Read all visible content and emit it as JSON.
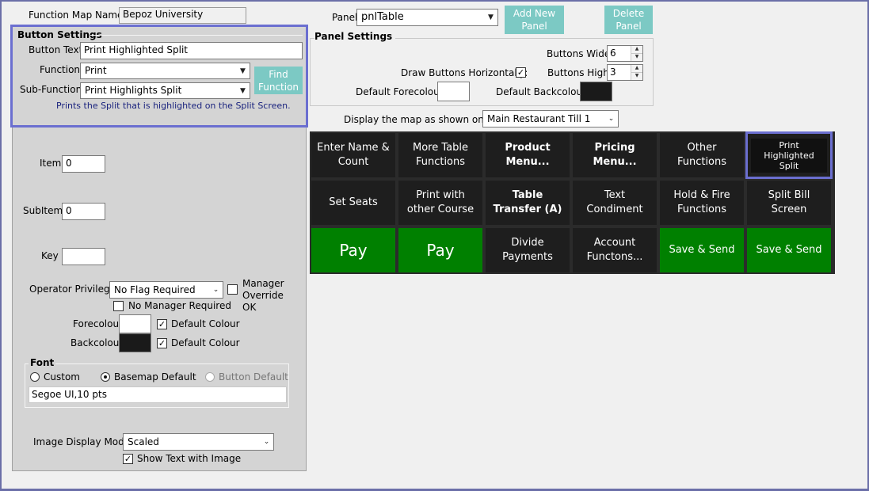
{
  "function_map": {
    "label": "Function Map Name:",
    "value": "Bepoz University"
  },
  "button_settings": {
    "title": "Button Settings",
    "button_text_label": "Button Text",
    "button_text_value": "Print Highlighted Split",
    "function_label": "Function",
    "function_value": "Print",
    "sub_function_label": "Sub-Function",
    "sub_function_value": "Print Highlights Split",
    "find_function_label": "Find Function",
    "description": "Prints the Split that is highlighted on the Split Screen."
  },
  "details": {
    "item_label": "Item",
    "item_value": "0",
    "subitem_label": "SubItem",
    "subitem_value": "0",
    "key_label": "Key",
    "key_value": "",
    "operator_privilege_label": "Operator Privilege:",
    "operator_privilege_value": "No Flag Required",
    "manager_override_label": "Manager Override OK",
    "no_manager_required_label": "No Manager Required",
    "forecolour_label": "Forecolour",
    "backcolour_label": "Backcolour",
    "default_colour_label": "Default Colour",
    "forecolour_hex": "#ffffff",
    "backcolour_hex": "#1a1a1a"
  },
  "font": {
    "title": "Font",
    "custom_label": "Custom",
    "basemap_label": "Basemap Default",
    "button_default_label": "Button Default",
    "selected": "Basemap Default",
    "value": "Segoe UI,10 pts"
  },
  "image": {
    "label": "Image Display Mode:",
    "value": "Scaled",
    "show_text_label": "Show Text with Image",
    "show_text_checked": true
  },
  "panel": {
    "label": "Panel",
    "value": "pnlTable",
    "add_new_label": "Add New Panel",
    "delete_label": "Delete Panel"
  },
  "panel_settings": {
    "title": "Panel Settings",
    "buttons_wide_label": "Buttons Wide:",
    "buttons_wide_value": "6",
    "buttons_high_label": "Buttons High:",
    "buttons_high_value": "3",
    "draw_horizontally_label": "Draw Buttons Horizontally:",
    "draw_horizontally_checked": true,
    "default_forecolour_label": "Default Forecolour",
    "default_backcolour_label": "Default Backcolour",
    "default_forecolour_hex": "#ffffff",
    "default_backcolour_hex": "#1a1a1a"
  },
  "display": {
    "label": "Display the map as shown on till:",
    "value": "Main Restaurant Till 1"
  },
  "map_buttons": [
    [
      "Enter Name & Count",
      "More Table Functions",
      "Product Menu...",
      "Pricing Menu...",
      "Other Functions",
      "Print Highlighted Split"
    ],
    [
      "Set Seats",
      "Print with other Course",
      "Table Transfer (A)",
      "Text Condiment",
      "Hold & Fire Functions",
      "Split Bill Screen"
    ],
    [
      "Pay",
      "Pay",
      "Divide Payments",
      "Account Functons...",
      "Save & Send",
      "Save & Send"
    ]
  ],
  "colors": {
    "accent_border": "#6b6fd0",
    "teal_button": "#7cc9c4",
    "green_button": "#008000",
    "dark_button": "#1e1e1e",
    "description_text": "#1a237e"
  }
}
